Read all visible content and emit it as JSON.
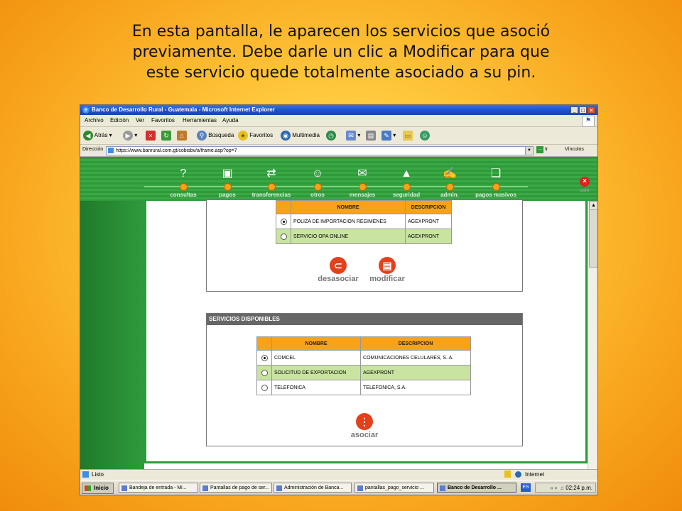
{
  "caption": [
    "En esta pantalla, le aparecen los servicios que asoció",
    "previamente. Debe darle un clic a Modificar para que",
    "este servicio quede totalmente asociado a su pin."
  ],
  "window": {
    "title": "Banco de Desarrollo Rural - Guatemala - Microsoft Internet Explorer"
  },
  "menu": [
    "Archivo",
    "Edición",
    "Ver",
    "Favoritos",
    "Herramientas",
    "Ayuda"
  ],
  "toolbar": {
    "back": "Atrás",
    "search": "Búsqueda",
    "favorites": "Favoritos",
    "multimedia": "Multimedia"
  },
  "address": {
    "label": "Dirección",
    "url": "https://www.banrural.com.gt/cobisbv/a/frame.asp?op=7",
    "go": "Ir",
    "links": "Vínculos"
  },
  "nav": [
    "consultas",
    "pagos",
    "transferencias",
    "otros",
    "mensajes",
    "seguridad",
    "admin.",
    "pagos masivos"
  ],
  "salir": "salir",
  "associated": {
    "headers": [
      "NOMBRE",
      "DESCRIPCION"
    ],
    "rows": [
      {
        "nombre": "POLIZA DE IMPORTACION REGIMENES",
        "descripcion": "AGEXPRONT"
      },
      {
        "nombre": "SERVICIO OPA ONLINE",
        "descripcion": "AGEXPRONT"
      }
    ],
    "desasociar": "desasociar",
    "modificar": "modificar"
  },
  "available": {
    "title": "SERVICIOS DISPONIBLES",
    "headers": [
      "NOMBRE",
      "DESCRIPCION"
    ],
    "rows": [
      {
        "nombre": "COMCEL",
        "descripcion": "COMUNICACIONES CELULARES, S. A."
      },
      {
        "nombre": "SOLICITUD DE EXPORTACION",
        "descripcion": "AGEXPRONT"
      },
      {
        "nombre": "TELEFONICA",
        "descripcion": "TELEFONICA, S.A."
      }
    ],
    "asociar": "asociar"
  },
  "status": {
    "text": "Listo",
    "zone": "Internet"
  },
  "taskbar": {
    "start": "Inicio",
    "tasks": [
      "Bandeja de entrada - Mi...",
      "Pantallas de pago de ser...",
      "Administración de Banca...",
      "pantallas_pago_servicio ...",
      "Banco de Desarrollo ..."
    ],
    "lang": "ES",
    "clock": "02:24 p.m."
  }
}
